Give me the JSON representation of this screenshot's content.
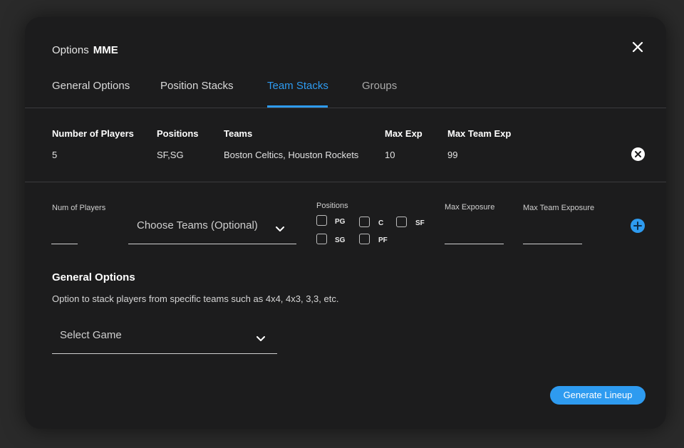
{
  "dialog": {
    "title_prefix": "Options",
    "title_mode": "MME",
    "close_icon": "close-icon"
  },
  "tabs": [
    {
      "label": "General Options",
      "active": false
    },
    {
      "label": "Position Stacks",
      "active": false
    },
    {
      "label": "Team Stacks",
      "active": true
    },
    {
      "label": "Groups",
      "active": false
    }
  ],
  "stack_table": {
    "headers": [
      "Number of Players",
      "Positions",
      "Teams",
      "Max Exp",
      "Max Team Exp"
    ],
    "rows": [
      [
        "5",
        "SF,SG",
        "Boston Celtics, Houston Rockets",
        "10",
        "99"
      ]
    ]
  },
  "add_stack_form": {
    "num_players_label": "Num of  Players",
    "num_players_value": "",
    "teams_select_placeholder": "Choose Teams (Optional)",
    "positions_label": "Positions",
    "positions": [
      {
        "code": "PG",
        "checked": false
      },
      {
        "code": "C",
        "checked": false
      },
      {
        "code": "SF",
        "checked": false
      },
      {
        "code": "SG",
        "checked": false
      },
      {
        "code": "PF",
        "checked": false
      }
    ],
    "max_exposure_label": "Max Exposure",
    "max_exposure_value": "",
    "max_team_exposure_label": "Max Team Exposure",
    "max_team_exposure_value": "",
    "add_icon": "plus-icon"
  },
  "general_options": {
    "heading": "General Options",
    "description": "Option to stack players from specific teams such as 4x4, 4x3, 3,3, etc.",
    "game_select_placeholder": "Select Game"
  },
  "footer": {
    "generate_button": "Generate Lineup"
  },
  "colors": {
    "accent": "#2e9bf0",
    "modal_bg": "#1c1c1d",
    "page_bg": "#2a2a2a"
  }
}
